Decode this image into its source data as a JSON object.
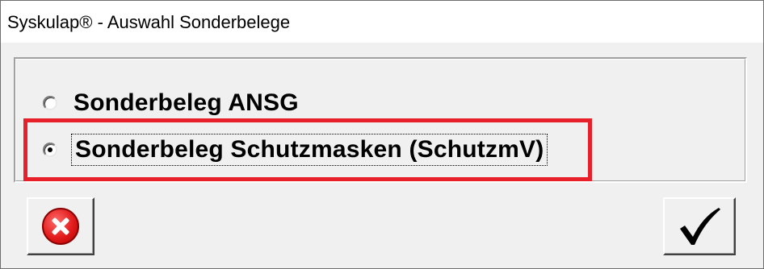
{
  "window": {
    "title": "Syskulap® - Auswahl Sonderbelege"
  },
  "options": [
    {
      "label": "Sonderbeleg ANSG",
      "selected": false
    },
    {
      "label": "Sonderbeleg Schutzmasken (SchutzmV)",
      "selected": true
    }
  ],
  "buttons": {
    "cancel_icon": "cancel-x-icon",
    "ok_icon": "checkmark-icon"
  },
  "colors": {
    "highlight": "#e8202a",
    "cancel": "#e21b1b"
  }
}
